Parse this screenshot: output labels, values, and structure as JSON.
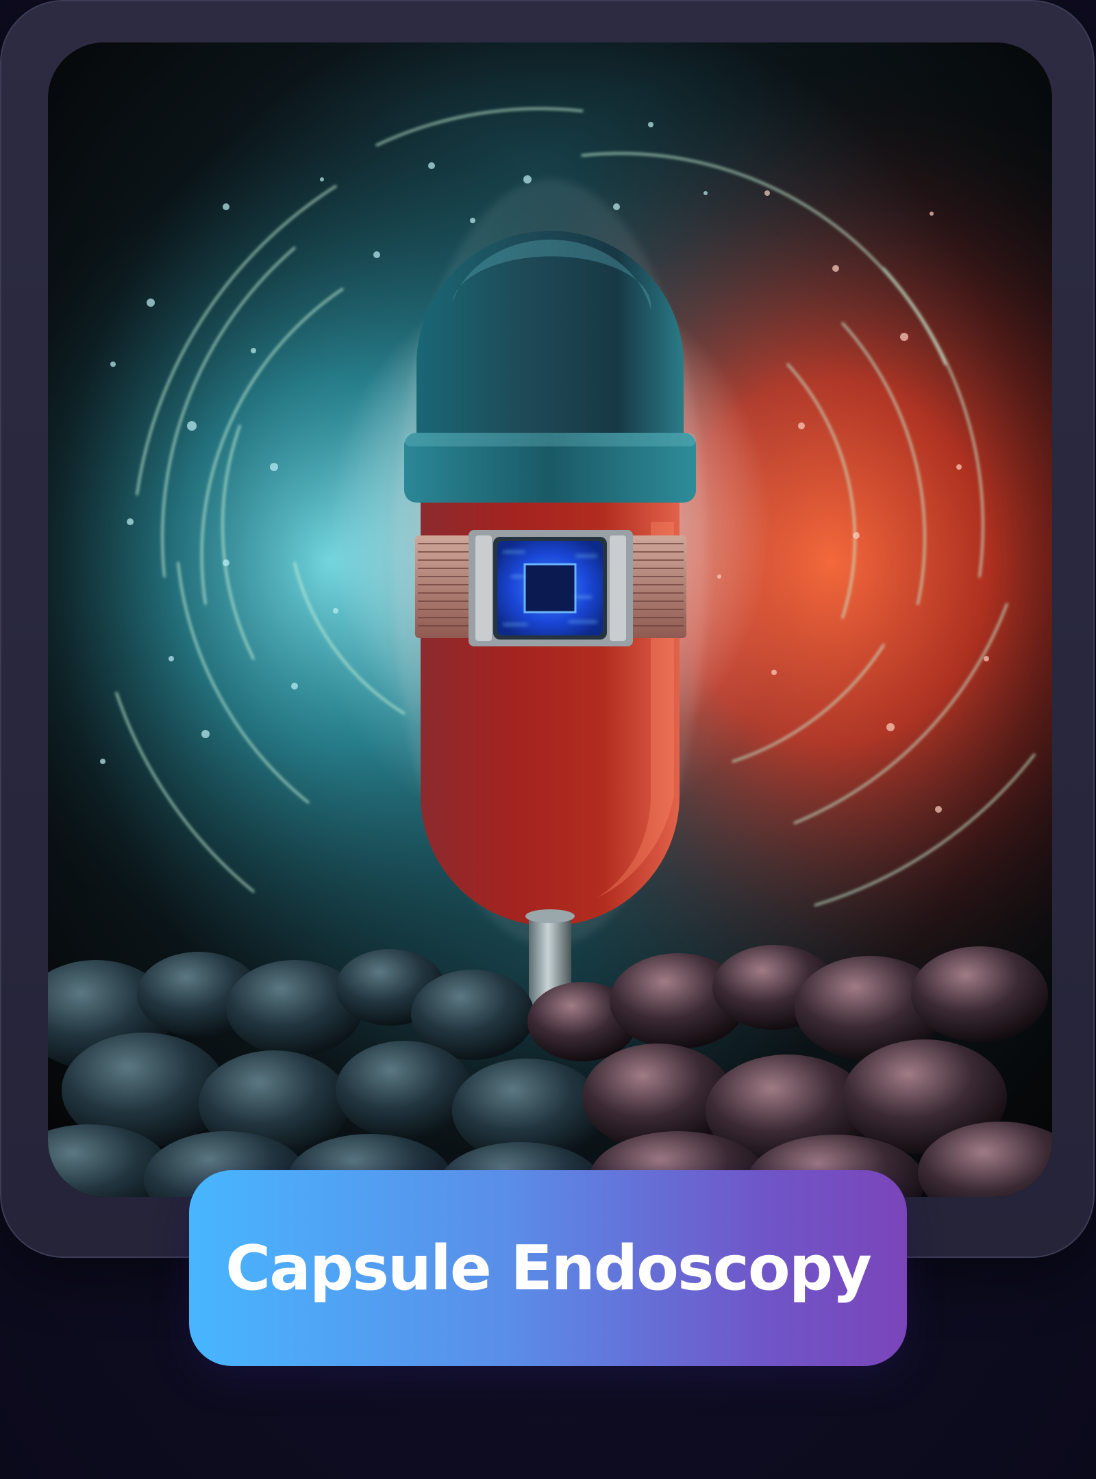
{
  "card": {
    "title": "Capsule Endoscopy",
    "image_subject": "capsule-illustration"
  },
  "colors": {
    "pill_gradient_start": "#48b6ff",
    "pill_gradient_end": "#7a45ba",
    "frame": "#2c2b42",
    "background": "#0d0b1f",
    "capsule_cap": "#1f5f6b",
    "capsule_body": "#a3231f",
    "glow_cyan": "#3fd0d8",
    "glow_red": "#ff4a2a",
    "chip_blue": "#1f63ff"
  }
}
